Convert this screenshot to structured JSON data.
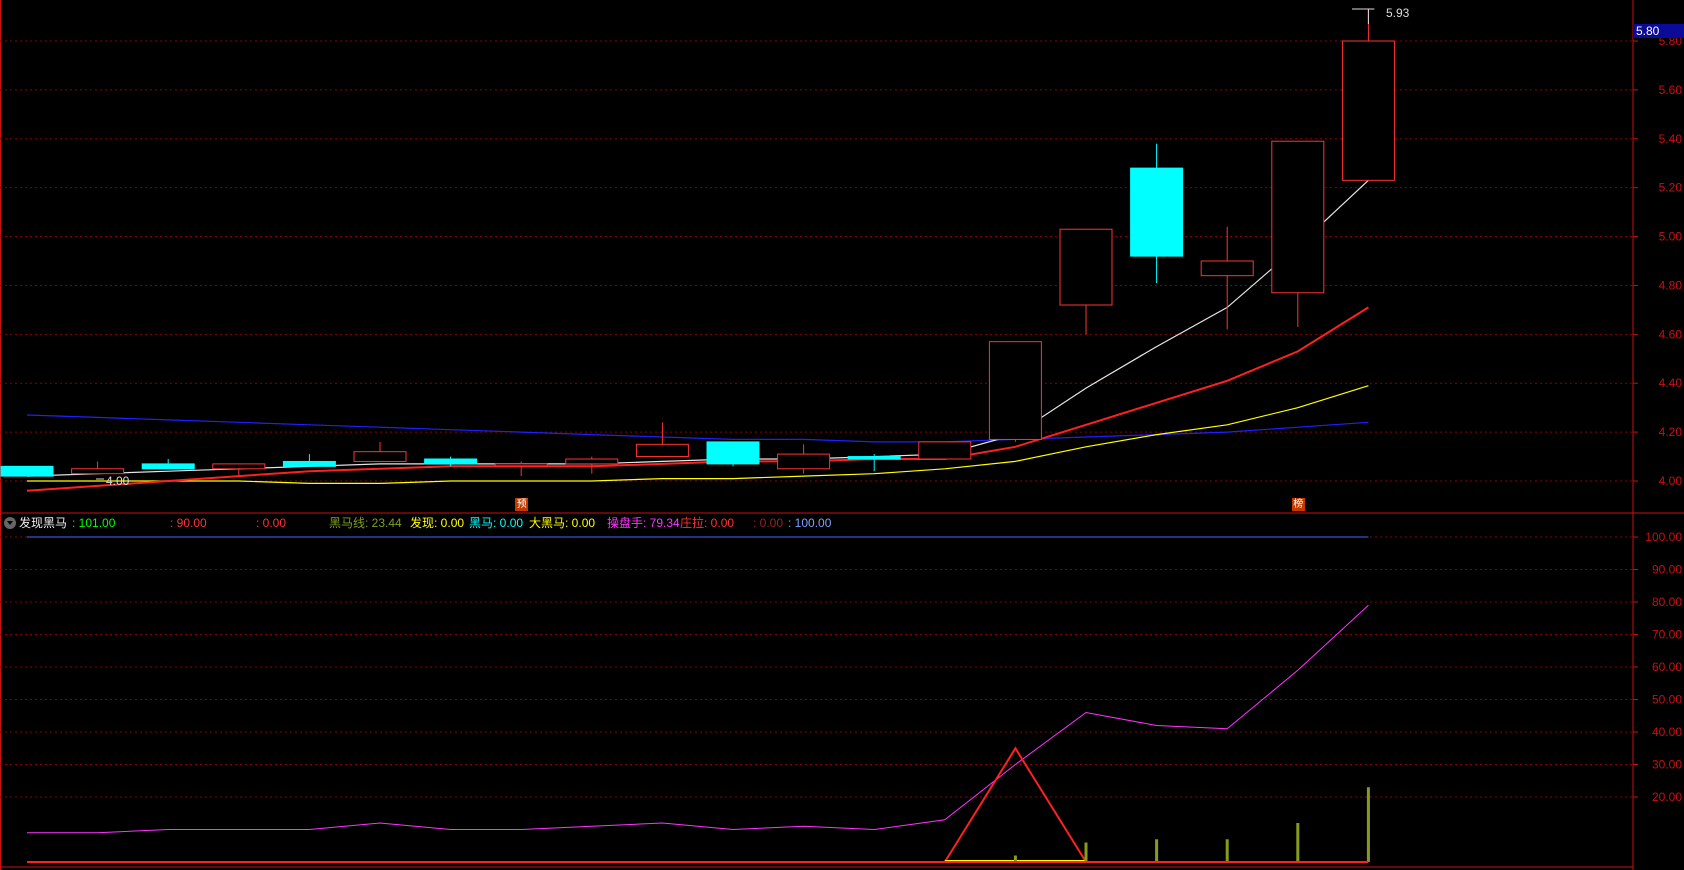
{
  "header": {
    "high_label": "5.93"
  },
  "price_tag": "5.80",
  "low_label": "4.00",
  "markers": [
    {
      "label": "预",
      "bar": 7
    },
    {
      "label": "榜",
      "bar": 18
    }
  ],
  "colors": {
    "up": "#ff3333",
    "down": "#00ffff",
    "ma_white": "#e6e6e6",
    "ma_red": "#ff2020",
    "ma_yellow": "#ffff00",
    "ma_blue": "#2020ff",
    "grid": "#8a0000",
    "axis": "#c81010"
  },
  "legend": {
    "title": "发现黑马",
    "items": [
      {
        "name": "",
        "text": ": 101.00",
        "color": "#00ff00"
      },
      {
        "name": "",
        "text": ": 90.00",
        "color": "#ff3333"
      },
      {
        "name": "",
        "text": ": 0.00",
        "color": "#ff3333"
      },
      {
        "name": "黑马线",
        "text": ": 23.44",
        "color": "#7f9f20"
      },
      {
        "name": "发现",
        "text": ": 0.00",
        "color": "#ffff00"
      },
      {
        "name": "黑马",
        "text": ": 0.00",
        "color": "#00ffff"
      },
      {
        "name": "大黑马",
        "text": ": 0.00",
        "color": "#ffff00"
      },
      {
        "name": "操盘手",
        "text": ": 79.34",
        "color": "#ff33ff"
      },
      {
        "name": "庄拉",
        "text": ": 0.00",
        "color": "#ff3333"
      },
      {
        "name": "",
        "text": ": 0.00",
        "color": "#992222"
      },
      {
        "name": "",
        "text": ": 100.00",
        "color": "#7aa0ff"
      }
    ]
  },
  "chart_data": [
    {
      "type": "candlestick",
      "y_ticks": [
        "4.00",
        "4.20",
        "4.40",
        "4.60",
        "4.80",
        "5.00",
        "5.20",
        "5.40",
        "5.60",
        "5.80"
      ],
      "ylim": [
        3.96,
        5.84
      ],
      "candles": [
        {
          "o": 4.06,
          "h": 4.06,
          "l": 4.02,
          "c": 4.02
        },
        {
          "o": 4.03,
          "h": 4.08,
          "l": 4.03,
          "c": 4.05
        },
        {
          "o": 4.07,
          "h": 4.09,
          "l": 4.05,
          "c": 4.05
        },
        {
          "o": 4.05,
          "h": 4.07,
          "l": 4.02,
          "c": 4.07
        },
        {
          "o": 4.08,
          "h": 4.11,
          "l": 4.06,
          "c": 4.06
        },
        {
          "o": 4.08,
          "h": 4.16,
          "l": 4.08,
          "c": 4.12
        },
        {
          "o": 4.09,
          "h": 4.1,
          "l": 4.06,
          "c": 4.07
        },
        {
          "o": 4.07,
          "h": 4.08,
          "l": 4.02,
          "c": 4.07
        },
        {
          "o": 4.07,
          "h": 4.1,
          "l": 4.03,
          "c": 4.09
        },
        {
          "o": 4.1,
          "h": 4.24,
          "l": 4.1,
          "c": 4.15
        },
        {
          "o": 4.16,
          "h": 4.16,
          "l": 4.06,
          "c": 4.07
        },
        {
          "o": 4.05,
          "h": 4.15,
          "l": 4.03,
          "c": 4.11
        },
        {
          "o": 4.1,
          "h": 4.11,
          "l": 4.04,
          "c": 4.09
        },
        {
          "o": 4.09,
          "h": 4.16,
          "l": 4.09,
          "c": 4.16
        },
        {
          "o": 4.17,
          "h": 4.57,
          "l": 4.16,
          "c": 4.57
        },
        {
          "o": 4.72,
          "h": 5.03,
          "l": 4.6,
          "c": 5.03
        },
        {
          "o": 5.28,
          "h": 5.38,
          "l": 4.81,
          "c": 4.92
        },
        {
          "o": 4.84,
          "h": 5.04,
          "l": 4.62,
          "c": 4.9
        },
        {
          "o": 4.77,
          "h": 5.39,
          "l": 4.63,
          "c": 5.39
        },
        {
          "o": 5.23,
          "h": 5.93,
          "l": 5.23,
          "c": 5.8
        }
      ],
      "ma_white": [
        4.02,
        4.03,
        4.04,
        4.05,
        4.06,
        4.07,
        4.07,
        4.07,
        4.07,
        4.08,
        4.09,
        4.09,
        4.1,
        4.11,
        4.19,
        4.38,
        4.55,
        4.71,
        4.96,
        5.23
      ],
      "ma_red": [
        3.96,
        3.98,
        4.0,
        4.02,
        4.04,
        4.05,
        4.06,
        4.06,
        4.06,
        4.07,
        4.08,
        4.08,
        4.09,
        4.09,
        4.14,
        4.23,
        4.32,
        4.41,
        4.53,
        4.71
      ],
      "ma_yellow": [
        4.0,
        4.0,
        4.0,
        4.0,
        3.99,
        3.99,
        4.0,
        4.0,
        4.0,
        4.01,
        4.01,
        4.02,
        4.03,
        4.05,
        4.08,
        4.14,
        4.19,
        4.23,
        4.3,
        4.39
      ],
      "ma_blue": [
        4.27,
        4.26,
        4.25,
        4.24,
        4.23,
        4.22,
        4.21,
        4.2,
        4.19,
        4.18,
        4.17,
        4.17,
        4.16,
        4.16,
        4.17,
        4.18,
        4.19,
        4.2,
        4.22,
        4.24
      ]
    },
    {
      "type": "line",
      "title": "发现黑马",
      "y_ticks": [
        "20.00",
        "30.00",
        "40.00",
        "50.00",
        "60.00",
        "70.00",
        "80.00",
        "90.00",
        "100.00"
      ],
      "ylim": [
        0,
        104
      ],
      "series": [
        {
          "name": "操盘手",
          "color": "#ff33ff",
          "values": [
            9,
            9,
            10,
            10,
            10,
            12,
            10,
            10,
            11,
            12,
            10,
            11,
            10,
            13,
            30,
            46,
            42,
            41,
            59,
            79
          ]
        },
        {
          "name": "庄拉",
          "color": "#ff2020",
          "values": [
            0,
            0,
            0,
            0,
            0,
            0,
            0,
            0,
            0,
            0,
            0,
            0,
            0,
            0,
            35,
            0,
            0,
            0,
            0,
            0
          ],
          "start": 13,
          "end": 15
        },
        {
          "name": "",
          "color": "#4466ff",
          "values": [
            100,
            100,
            100,
            100,
            100,
            100,
            100,
            100,
            100,
            100,
            100,
            100,
            100,
            100,
            100,
            100,
            100,
            100,
            100,
            100
          ]
        },
        {
          "name": "黑马线",
          "type": "bar",
          "color": "#8a9a1a",
          "values": [
            0,
            0,
            0,
            0,
            0,
            0,
            0,
            0,
            0,
            0,
            0,
            0,
            0,
            0,
            2,
            6,
            7,
            7,
            12,
            23
          ]
        }
      ]
    }
  ]
}
